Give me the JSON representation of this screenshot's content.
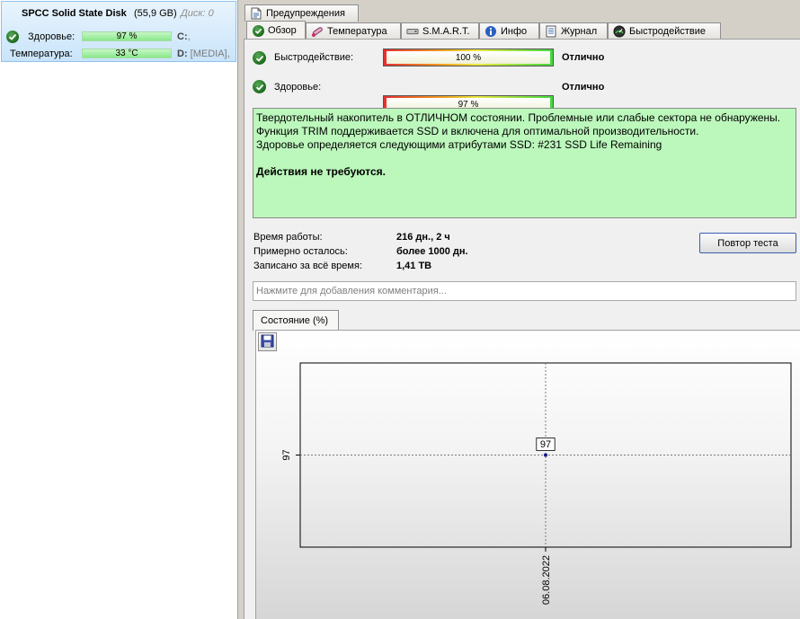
{
  "disk": {
    "title": "SPCC Solid State Disk",
    "size": "(55,9 GB)",
    "disk_num": "Диск: 0",
    "health_label": "Здоровье:",
    "health_value": "97 %",
    "temp_label": "Температура:",
    "temp_value": "33 °C",
    "drive_c": "C:",
    "drive_c_rest": ",",
    "drive_d": "D:",
    "drive_d_rest": " [MEDIA],"
  },
  "tabs_top": [
    {
      "label": "Предупреждения",
      "icon": "document-icon"
    }
  ],
  "tabs": [
    {
      "label": "Обзор",
      "icon": "check-circle-icon",
      "active": true
    },
    {
      "label": "Температура",
      "icon": "thermometer-icon"
    },
    {
      "label": "S.M.A.R.T.",
      "icon": "hdd-icon"
    },
    {
      "label": "Инфо",
      "icon": "info-icon"
    },
    {
      "label": "Журнал",
      "icon": "journal-icon"
    },
    {
      "label": "Быстродействие",
      "icon": "gauge-icon"
    }
  ],
  "overview": {
    "performance_label": "Быстродействие:",
    "performance_value": "100 %",
    "performance_pct": 100,
    "performance_status": "Отлично",
    "health_label": "Здоровье:",
    "health_value": "97 %",
    "health_pct": 97,
    "health_status": "Отлично",
    "summary_lines": [
      "Твердотельный накопитель в ОТЛИЧНОМ состоянии. Проблемные или слабые сектора не обнаружены.",
      "Функция TRIM поддерживается SSD и включена для оптимальной производительности.",
      "Здоровье определяется следующими атрибутами SSD: #231 SSD Life Remaining"
    ],
    "summary_action": "Действия не требуются.",
    "uptime_label": "Время работы:",
    "uptime_value": "216 дн., 2 ч",
    "remaining_label": "Примерно осталось:",
    "remaining_value": "более 1000 дн.",
    "written_label": "Записано за всё время:",
    "written_value": "1,41 TB",
    "retest_button": "Повтор теста",
    "comment_placeholder": "Нажмите для добавления комментария..."
  },
  "chart_tab": "Состояние (%)",
  "chart_data": {
    "type": "line",
    "x": [
      "06.08.2022"
    ],
    "series": [
      {
        "values": [
          97
        ]
      }
    ],
    "point_labels": [
      "97"
    ],
    "y_tick_labels": [
      "97"
    ],
    "x_tick_labels": [
      "06.08.2022"
    ],
    "grid": true,
    "colors": {
      "point": "#1a1a8a",
      "grid": "#7a7a7a"
    }
  },
  "colors": {
    "ok_green": "#2b8a2b",
    "summary_bg": "#bcf7bc",
    "selected_card": "#c9e4fa"
  }
}
